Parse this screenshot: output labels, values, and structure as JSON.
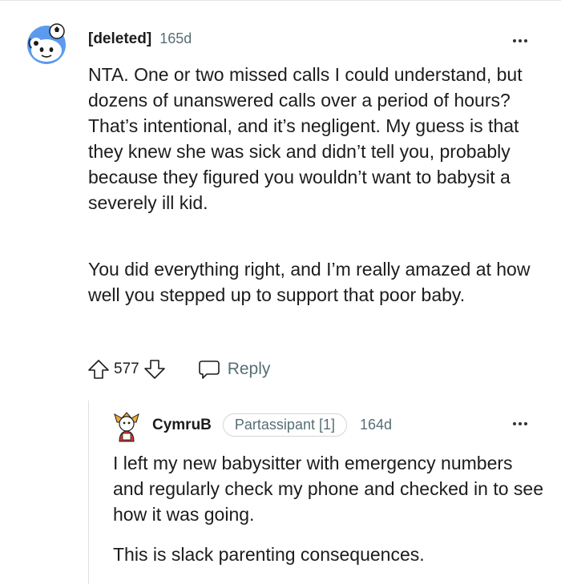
{
  "comment": {
    "username": "[deleted]",
    "age": "165d",
    "paragraphs": [
      "NTA. One or two missed calls I could understand, but dozens of unanswered calls over a period of hours? That’s intentional, and it’s negligent. My guess is that they knew she was sick and didn’t tell you, probably because they figured you wouldn’t want to babysit a severely ill kid.",
      "You did everything right, and I’m really amazed at how well you stepped up to support that poor baby."
    ],
    "score": "577",
    "reply_label": "Reply"
  },
  "reply": {
    "username": "CymruB",
    "flair": "Partassipant [1]",
    "age": "164d",
    "paragraphs": [
      "I left my new babysitter with emergency numbers and regularly check my phone and checked in to see how it was going.",
      "This is slack parenting consequences."
    ]
  },
  "colors": {
    "avatar_blue": "#5a9bef",
    "meta_gray": "#576f76",
    "text": "#1c1c1c",
    "reply_avatar_red": "#d0392e"
  }
}
